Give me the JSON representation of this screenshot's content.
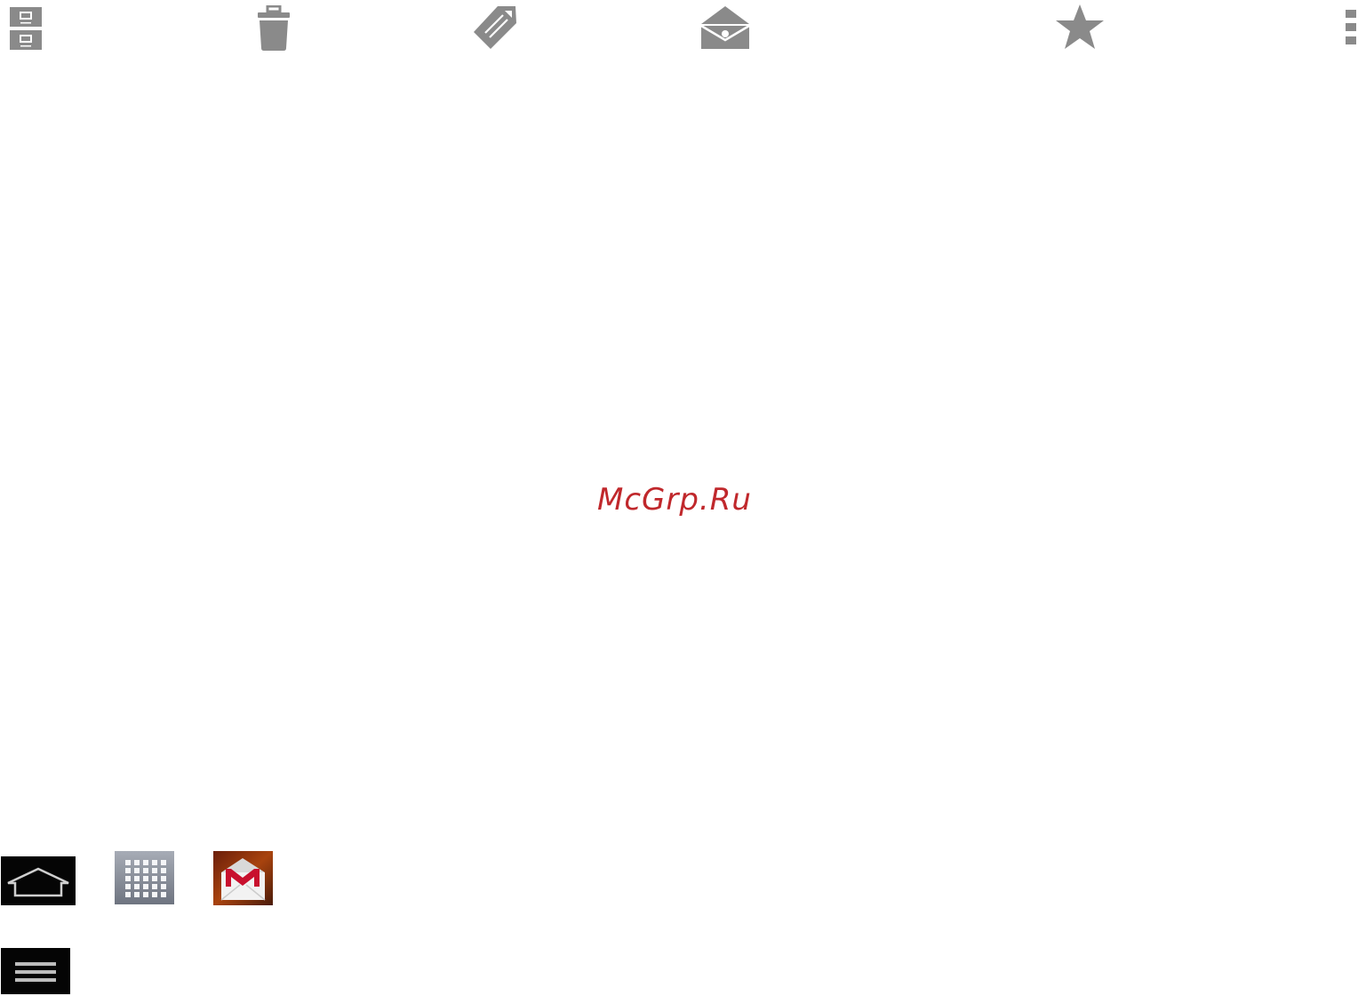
{
  "watermark": {
    "text": "McGrp.Ru"
  },
  "toolbar": {
    "icons": [
      "archive-icon",
      "trash-icon",
      "label-icon",
      "move-to-inbox-icon",
      "star-icon",
      "overflow-menu-icon"
    ],
    "icon_color": "#8a8a8a"
  },
  "nav_buttons": {
    "icons": [
      "home-icon",
      "apps-grid-icon",
      "gmail-icon",
      "menu-icon"
    ],
    "accent_red": "#c8102e"
  }
}
